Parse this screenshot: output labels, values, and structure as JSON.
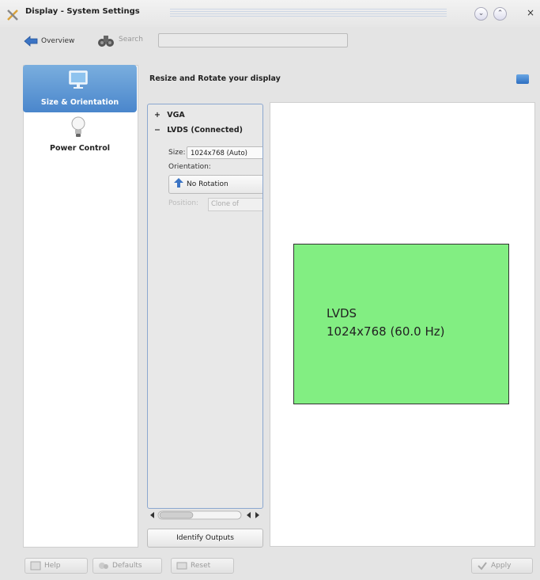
{
  "window": {
    "title": "Display - System Settings",
    "close_glyph": "×"
  },
  "toolbar": {
    "overview_label": "Overview",
    "search_label": "Search",
    "search_value": ""
  },
  "sidebar": {
    "items": [
      {
        "label": "Size & Orientation",
        "icon": "monitor-icon",
        "selected": true
      },
      {
        "label": "Power Control",
        "icon": "lightbulb-icon",
        "selected": false
      }
    ]
  },
  "main": {
    "header": "Resize and Rotate your display",
    "outputs": [
      {
        "expander": "+",
        "label": "VGA"
      },
      {
        "expander": "−",
        "label": "LVDS (Connected)"
      }
    ],
    "size_label": "Size:",
    "size_value": "1024x768 (Auto)",
    "orientation_label": "Orientation:",
    "orientation_value": "No Rotation",
    "position_label": "Position:",
    "position_value": "Clone of",
    "identify_label": "Identify Outputs",
    "preview": {
      "name": "LVDS",
      "mode": "1024x768 (60.0 Hz)",
      "color": "#82ee82"
    }
  },
  "buttons": {
    "help": "Help",
    "defaults": "Defaults",
    "reset": "Reset",
    "apply": "Apply"
  }
}
